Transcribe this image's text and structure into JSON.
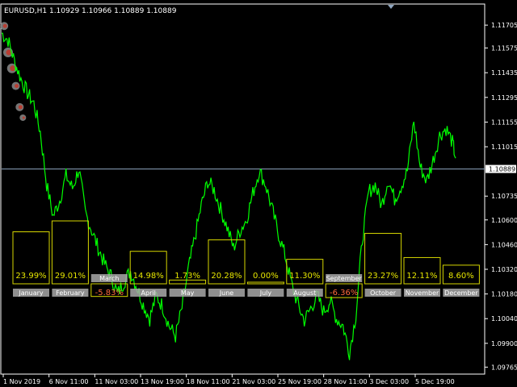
{
  "window": {
    "symbol_line": "EURUSD,H1  1.10929 1.10966 1.10889 1.10889"
  },
  "colors": {
    "background": "#000000",
    "price_line": "#00ff00",
    "grid_line": "#8fa6c0",
    "box_stroke": "#d6d600",
    "positive_text": "#e6e600",
    "negative_text": "#ff6a3d",
    "label_bg": "#a8a8a8",
    "label_text": "#ffffff",
    "axis_text": "#ffffff",
    "current_price_bg": "#ffffff",
    "current_price_text": "#000000"
  },
  "chart_data": {
    "type": "line",
    "symbol": "EURUSD",
    "timeframe": "H1",
    "ohlc": {
      "open": 1.10929,
      "high": 1.10966,
      "low": 1.10889,
      "close": 1.10889
    },
    "ylim": [
      1.0973,
      1.1182
    ],
    "y_ticks": [
      "1.11705",
      "1.11575",
      "1.11435",
      "1.11295",
      "1.11155",
      "1.11015",
      "1.10735",
      "1.10600",
      "1.10460",
      "1.10320",
      "1.10180",
      "1.10040",
      "1.09900",
      "1.09765"
    ],
    "current_price": 1.10889,
    "current_price_label": "1.10889",
    "x_ticks": [
      "1 Nov 2019",
      "6 Nov 11:00",
      "11 Nov 03:00",
      "13 Nov 19:00",
      "18 Nov 11:00",
      "21 Nov 03:00",
      "25 Nov 19:00",
      "28 Nov 11:00",
      "3 Dec 03:00",
      "5 Dec 19:00"
    ],
    "price_series": [
      [
        0,
        1.1166
      ],
      [
        2,
        1.1162
      ],
      [
        4,
        1.115
      ],
      [
        6,
        1.114
      ],
      [
        8,
        1.1132
      ],
      [
        10,
        1.1126
      ],
      [
        12,
        1.111
      ],
      [
        14,
        1.108
      ],
      [
        16,
        1.1062
      ],
      [
        18,
        1.1071
      ],
      [
        20,
        1.1085
      ],
      [
        22,
        1.1078
      ],
      [
        24,
        1.1089
      ],
      [
        26,
        1.1064
      ],
      [
        28,
        1.1054
      ],
      [
        30,
        1.1044
      ],
      [
        32,
        1.1035
      ],
      [
        34,
        1.1028
      ],
      [
        36,
        1.1018
      ],
      [
        38,
        1.1025
      ],
      [
        40,
        1.1031
      ],
      [
        42,
        1.1022
      ],
      [
        44,
        1.1012
      ],
      [
        46,
        1.1004
      ],
      [
        48,
        1.1017
      ],
      [
        50,
        1.1011
      ],
      [
        52,
        1.1
      ],
      [
        54,
        1.0994
      ],
      [
        56,
        1.101
      ],
      [
        58,
        1.1032
      ],
      [
        60,
        1.105
      ],
      [
        62,
        1.1068
      ],
      [
        64,
        1.1082
      ],
      [
        66,
        1.1077
      ],
      [
        68,
        1.1066
      ],
      [
        70,
        1.1056
      ],
      [
        72,
        1.1044
      ],
      [
        74,
        1.1054
      ],
      [
        76,
        1.106
      ],
      [
        78,
        1.1075
      ],
      [
        80,
        1.1088
      ],
      [
        82,
        1.108
      ],
      [
        84,
        1.1066
      ],
      [
        86,
        1.1052
      ],
      [
        88,
        1.104
      ],
      [
        90,
        1.1024
      ],
      [
        92,
        1.1012
      ],
      [
        94,
        1.1003
      ],
      [
        96,
        1.101
      ],
      [
        98,
        1.1017
      ],
      [
        100,
        1.1008
      ],
      [
        102,
        1.1014
      ],
      [
        104,
        1.1004
      ],
      [
        106,
        1.1
      ],
      [
        108,
        1.0985
      ],
      [
        110,
        1.1006
      ],
      [
        112,
        1.1049
      ],
      [
        114,
        1.1076
      ],
      [
        116,
        1.108
      ],
      [
        118,
        1.1068
      ],
      [
        120,
        1.1083
      ],
      [
        122,
        1.1072
      ],
      [
        124,
        1.1079
      ],
      [
        126,
        1.1088
      ],
      [
        128,
        1.1116
      ],
      [
        130,
        1.109
      ],
      [
        132,
        1.1082
      ],
      [
        134,
        1.1094
      ],
      [
        136,
        1.1108
      ],
      [
        138,
        1.1112
      ],
      [
        140,
        1.1104
      ],
      [
        141,
        1.1095
      ]
    ],
    "xlim": [
      0,
      150
    ],
    "months": [
      {
        "name": "January",
        "value": "23.99%",
        "positive": true,
        "v": 23.99
      },
      {
        "name": "February",
        "value": "29.01%",
        "positive": true,
        "v": 29.01
      },
      {
        "name": "March",
        "value": "-5.83%",
        "positive": false,
        "v": -5.83
      },
      {
        "name": "April",
        "value": "14.98%",
        "positive": true,
        "v": 14.98
      },
      {
        "name": "May",
        "value": "1.73%",
        "positive": true,
        "v": 1.73
      },
      {
        "name": "June",
        "value": "20.28%",
        "positive": true,
        "v": 20.28
      },
      {
        "name": "July",
        "value": "0.00%",
        "positive": true,
        "v": 0.0
      },
      {
        "name": "August",
        "value": "11.30%",
        "positive": true,
        "v": 11.3
      },
      {
        "name": "September",
        "value": "-6.36%",
        "positive": false,
        "v": -6.36
      },
      {
        "name": "October",
        "value": "23.27%",
        "positive": true,
        "v": 23.27
      },
      {
        "name": "November",
        "value": "12.11%",
        "positive": true,
        "v": 12.11
      },
      {
        "name": "December",
        "value": "8.60%",
        "positive": true,
        "v": 8.6
      }
    ],
    "months_scale_max": 29.01
  }
}
